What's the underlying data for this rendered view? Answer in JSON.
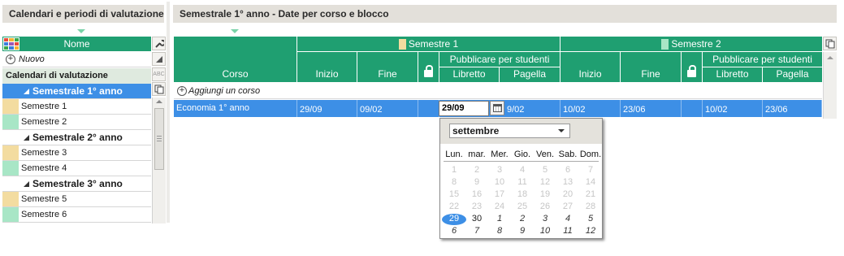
{
  "left_panel": {
    "title": "Calendari e periodi di valutazione",
    "column_header": "Nome",
    "new_label": "Nuovo",
    "section_header": "Calendari di valutazione",
    "rows": [
      {
        "label": "Semestrale 1° anno",
        "type": "group",
        "selected": true
      },
      {
        "label": "Semestre 1",
        "type": "item",
        "color": "#f3dca0"
      },
      {
        "label": "Semestre 2",
        "type": "item",
        "color": "#a8e6c6"
      },
      {
        "label": "Semestrale 2° anno",
        "type": "group",
        "selected": false
      },
      {
        "label": "Semestre 3",
        "type": "item",
        "color": "#f3dca0"
      },
      {
        "label": "Semestre 4",
        "type": "item",
        "color": "#a8e6c6"
      },
      {
        "label": "Semestrale 3° anno",
        "type": "group",
        "selected": false
      },
      {
        "label": "Semestre 5",
        "type": "item",
        "color": "#f3dca0"
      },
      {
        "label": "Semestre 6",
        "type": "item",
        "color": "#a8e6c6"
      }
    ],
    "tool_buttons": [
      "wrench-icon",
      "sort-icon",
      "spellcheck-icon",
      "copy-icon"
    ],
    "abc_label": "ABC"
  },
  "right_panel": {
    "title": "Semestrale 1° anno - Date per corso e blocco",
    "headers": {
      "corso": "Corso",
      "semestre1": "Semestre 1",
      "semestre2": "Semestre 2",
      "pubblicare": "Pubblicare per studenti",
      "inizio": "Inizio",
      "fine": "Fine",
      "libretto": "Libretto",
      "pagella": "Pagella"
    },
    "semestre1_color": "#f3dca0",
    "semestre2_color": "#a8e6c6",
    "add_course_label": "Aggiungi un corso",
    "row": {
      "corso": "Economia 1° anno",
      "s1_inizio": "29/09",
      "s1_fine": "09/02",
      "s1_libretto": "29/09",
      "s1_pagella": "9/02",
      "s2_inizio": "10/02",
      "s2_fine": "23/06",
      "s2_libretto": "10/02",
      "s2_pagella": "23/06"
    }
  },
  "date_picker": {
    "month": "settembre",
    "weekdays": [
      "Lun.",
      "mar.",
      "Mer.",
      "Gio.",
      "Ven.",
      "Sab.",
      "Dom."
    ],
    "weeks": [
      [
        {
          "d": "1",
          "s": "dim"
        },
        {
          "d": "2",
          "s": "dim"
        },
        {
          "d": "3",
          "s": "dim"
        },
        {
          "d": "4",
          "s": "dim"
        },
        {
          "d": "5",
          "s": "dim"
        },
        {
          "d": "6",
          "s": "dim"
        },
        {
          "d": "7",
          "s": "dim"
        }
      ],
      [
        {
          "d": "8",
          "s": "dim"
        },
        {
          "d": "9",
          "s": "dim"
        },
        {
          "d": "10",
          "s": "dim"
        },
        {
          "d": "11",
          "s": "dim"
        },
        {
          "d": "12",
          "s": "dim"
        },
        {
          "d": "13",
          "s": "dim"
        },
        {
          "d": "14",
          "s": "dim"
        }
      ],
      [
        {
          "d": "15",
          "s": "dim"
        },
        {
          "d": "16",
          "s": "dim"
        },
        {
          "d": "17",
          "s": "dim"
        },
        {
          "d": "18",
          "s": "dim"
        },
        {
          "d": "19",
          "s": "dim"
        },
        {
          "d": "20",
          "s": "dim"
        },
        {
          "d": "21",
          "s": "dim"
        }
      ],
      [
        {
          "d": "22",
          "s": "dim"
        },
        {
          "d": "23",
          "s": "dim"
        },
        {
          "d": "24",
          "s": "dim"
        },
        {
          "d": "25",
          "s": "dim"
        },
        {
          "d": "26",
          "s": "dim"
        },
        {
          "d": "27",
          "s": "dim"
        },
        {
          "d": "28",
          "s": "dim"
        }
      ],
      [
        {
          "d": "29",
          "s": "today"
        },
        {
          "d": "30",
          "s": "cur"
        },
        {
          "d": "1",
          "s": "next"
        },
        {
          "d": "2",
          "s": "next"
        },
        {
          "d": "3",
          "s": "next"
        },
        {
          "d": "4",
          "s": "next"
        },
        {
          "d": "5",
          "s": "next"
        }
      ],
      [
        {
          "d": "6",
          "s": "next"
        },
        {
          "d": "7",
          "s": "next"
        },
        {
          "d": "8",
          "s": "next"
        },
        {
          "d": "9",
          "s": "next"
        },
        {
          "d": "10",
          "s": "next"
        },
        {
          "d": "11",
          "s": "next"
        },
        {
          "d": "12",
          "s": "next"
        }
      ]
    ],
    "selected_color": "#3d8fe6"
  },
  "colors": {
    "header_green": "#1f9f71",
    "selection_blue": "#3d8fe6",
    "panel_gray": "#e3e0da"
  }
}
